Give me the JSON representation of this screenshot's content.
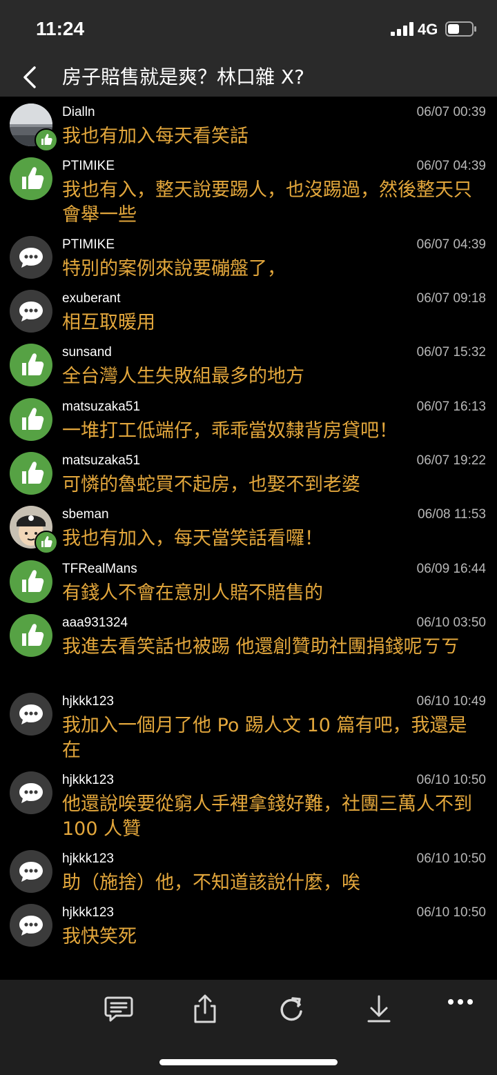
{
  "status_bar": {
    "time": "11:24",
    "network": "4G"
  },
  "header": {
    "title": "房子賠售就是爽？林口雜 X?"
  },
  "comments": [
    {
      "user": "Dialln",
      "time": "06/07 00:39",
      "text": "我也有加入每天看笑話",
      "avatar": "photo-sea",
      "badge": "like"
    },
    {
      "user": "PTIMIKE",
      "time": "06/07 04:39",
      "text": "我也有入，整天說要踢人，也沒踢過，然後整天只會舉一些",
      "avatar": "thumbs-up-icon"
    },
    {
      "user": "PTIMIKE",
      "time": "06/07 04:39",
      "text": "特別的案例來說要磞盤了，",
      "avatar": "chat-bubble-icon"
    },
    {
      "user": "exuberant",
      "time": "06/07 09:18",
      "text": "相互取暖用",
      "avatar": "chat-bubble-icon"
    },
    {
      "user": "sunsand",
      "time": "06/07 15:32",
      "text": "全台灣人生失敗組最多的地方",
      "avatar": "thumbs-up-icon"
    },
    {
      "user": "matsuzaka51",
      "time": "06/07 16:13",
      "text": "一堆打工低端仔，乖乖當奴隸背房貸吧！",
      "avatar": "thumbs-up-icon"
    },
    {
      "user": "matsuzaka51",
      "time": "06/07 19:22",
      "text": "可憐的魯蛇買不起房，也娶不到老婆",
      "avatar": "thumbs-up-icon"
    },
    {
      "user": "sbeman",
      "time": "06/08 11:53",
      "text": "我也有加入，每天當笑話看囉！",
      "avatar": "photo-cartoon",
      "badge": "like"
    },
    {
      "user": "TFRealMans",
      "time": "06/09 16:44",
      "text": "有錢人不會在意別人賠不賠售的",
      "avatar": "thumbs-up-icon"
    },
    {
      "user": "aaa931324",
      "time": "06/10 03:50",
      "text": "我進去看笑話也被踢 他還創贊助社團捐錢呢ㄎㄎ",
      "avatar": "thumbs-up-icon"
    },
    {
      "user": "hjkkk123",
      "time": "06/10 10:49",
      "text": "我加入一個月了他 Po 踢人文 10 篇有吧，我還是在",
      "avatar": "chat-bubble-icon"
    },
    {
      "user": "hjkkk123",
      "time": "06/10 10:50",
      "text": "他還說唉要從窮人手裡拿錢好難，社團三萬人不到 100 人贊",
      "avatar": "chat-bubble-icon"
    },
    {
      "user": "hjkkk123",
      "time": "06/10 10:50",
      "text": "助（施捨）他，不知道該說什麼，唉",
      "avatar": "chat-bubble-icon"
    },
    {
      "user": "hjkkk123",
      "time": "06/10 10:50",
      "text": "我快笑死",
      "avatar": "chat-bubble-icon"
    }
  ],
  "colors": {
    "background": "#000000",
    "bar": "#2a2a2a",
    "comment_text": "#e3a73c",
    "like_green": "#56a244",
    "chat_gray": "#3b3b3b",
    "timestamp": "#b8b8b8"
  },
  "toolbar": {
    "icons": [
      "comment-icon",
      "share-icon",
      "refresh-icon",
      "download-icon",
      "more-icon"
    ]
  }
}
